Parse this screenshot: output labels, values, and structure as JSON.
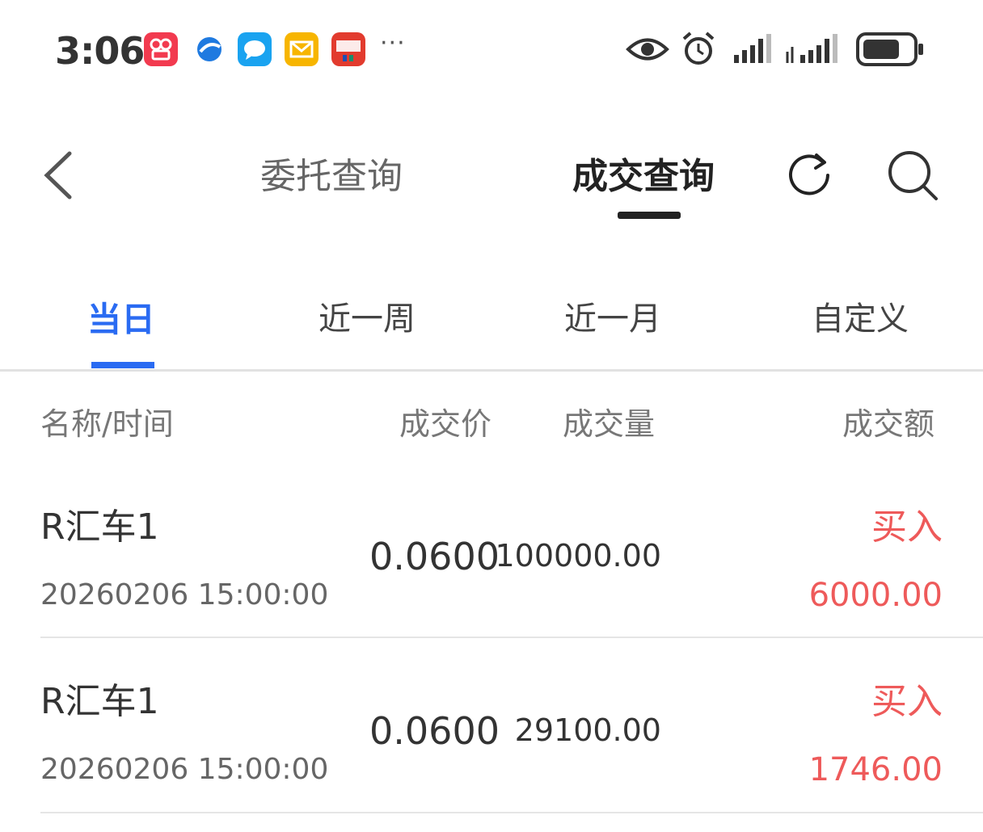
{
  "status_bar": {
    "time": "3:06",
    "more": "···",
    "notification_icons": [
      {
        "name": "kuaishou-app-icon",
        "color": "#f23a4f"
      },
      {
        "name": "browser-app-icon",
        "color": "#1f7ae0"
      },
      {
        "name": "message-app-icon",
        "color": "#1aa3f0"
      },
      {
        "name": "mail-app-icon",
        "color": "#f7b500"
      },
      {
        "name": "unionpay-app-icon",
        "color": "#e23b2e"
      }
    ]
  },
  "header": {
    "tabs": [
      {
        "label": "委托查询",
        "active": false
      },
      {
        "label": "成交查询",
        "active": true
      }
    ]
  },
  "period_tabs": [
    {
      "label": "当日",
      "active": true
    },
    {
      "label": "近一周",
      "active": false
    },
    {
      "label": "近一月",
      "active": false
    },
    {
      "label": "自定义",
      "active": false
    }
  ],
  "columns": {
    "name_time": "名称/时间",
    "price": "成交价",
    "volume": "成交量",
    "amount": "成交额"
  },
  "trades": [
    {
      "name": "R汇车1",
      "time": "20260206 15:00:00",
      "price": "0.0600",
      "volume": "100000.00",
      "side": "买入",
      "amount": "6000.00"
    },
    {
      "name": "R汇车1",
      "time": "20260206 15:00:00",
      "price": "0.0600",
      "volume": "29100.00",
      "side": "买入",
      "amount": "1746.00"
    }
  ],
  "colors": {
    "accent": "#2a6bf2",
    "buy": "#ee5a5a",
    "text": "#222222"
  }
}
